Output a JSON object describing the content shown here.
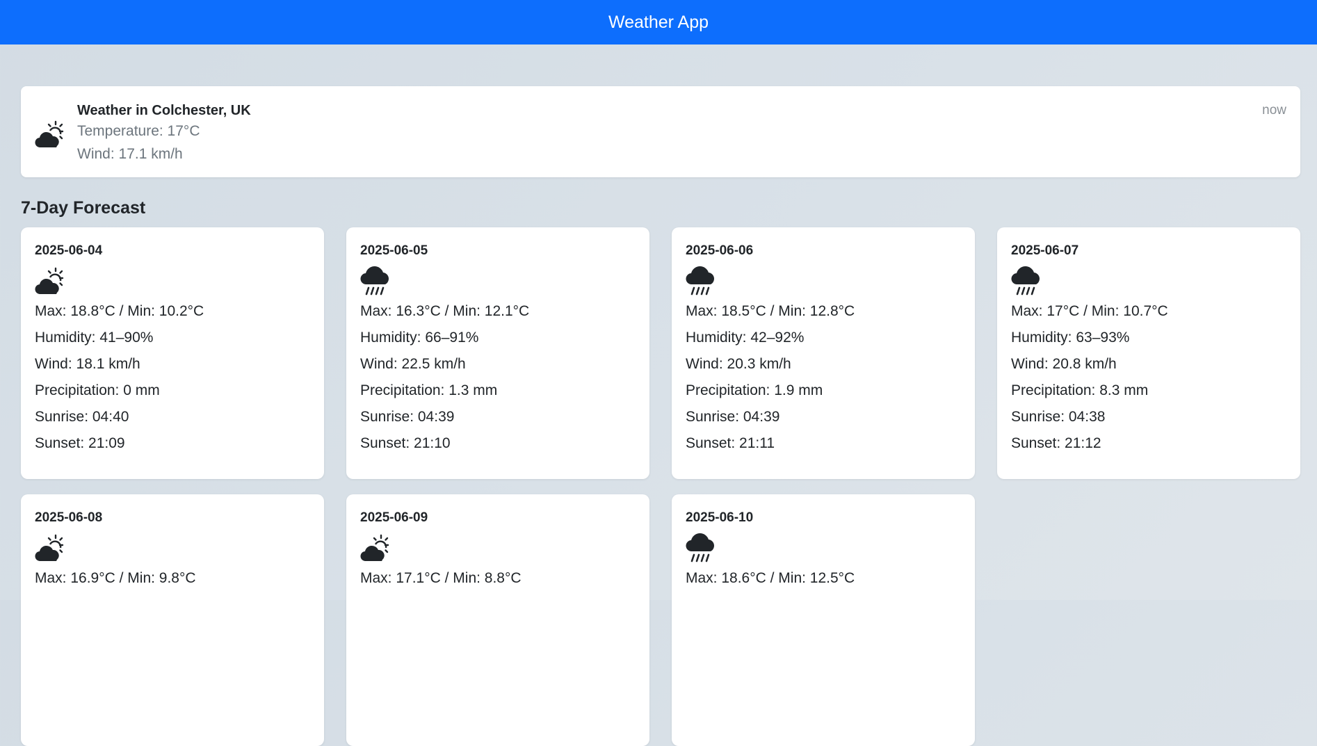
{
  "header": {
    "title": "Weather App"
  },
  "current": {
    "title": "Weather in Colchester, UK",
    "temperature": "Temperature: 17°C",
    "wind": "Wind: 17.1 km/h",
    "time": "now",
    "icon": "partly-cloudy-icon"
  },
  "forecast": {
    "title": "7-Day Forecast",
    "days": [
      {
        "date": "2025-06-04",
        "icon": "partly-cloudy-icon",
        "maxmin": "Max: 18.8°C / Min: 10.2°C",
        "humidity": "Humidity: 41–90%",
        "wind": "Wind: 18.1 km/h",
        "precipitation": "Precipitation: 0 mm",
        "sunrise": "Sunrise: 04:40",
        "sunset": "Sunset: 21:09"
      },
      {
        "date": "2025-06-05",
        "icon": "rain-cloud-icon",
        "maxmin": "Max: 16.3°C / Min: 12.1°C",
        "humidity": "Humidity: 66–91%",
        "wind": "Wind: 22.5 km/h",
        "precipitation": "Precipitation: 1.3 mm",
        "sunrise": "Sunrise: 04:39",
        "sunset": "Sunset: 21:10"
      },
      {
        "date": "2025-06-06",
        "icon": "rain-cloud-icon",
        "maxmin": "Max: 18.5°C / Min: 12.8°C",
        "humidity": "Humidity: 42–92%",
        "wind": "Wind: 20.3 km/h",
        "precipitation": "Precipitation: 1.9 mm",
        "sunrise": "Sunrise: 04:39",
        "sunset": "Sunset: 21:11"
      },
      {
        "date": "2025-06-07",
        "icon": "rain-cloud-icon",
        "maxmin": "Max: 17°C / Min: 10.7°C",
        "humidity": "Humidity: 63–93%",
        "wind": "Wind: 20.8 km/h",
        "precipitation": "Precipitation: 8.3 mm",
        "sunrise": "Sunrise: 04:38",
        "sunset": "Sunset: 21:12"
      },
      {
        "date": "2025-06-08",
        "icon": "partly-cloudy-icon",
        "maxmin": "Max: 16.9°C / Min: 9.8°C"
      },
      {
        "date": "2025-06-09",
        "icon": "partly-cloudy-icon",
        "maxmin": "Max: 17.1°C / Min: 8.8°C"
      },
      {
        "date": "2025-06-10",
        "icon": "rain-cloud-icon",
        "maxmin": "Max: 18.6°C / Min: 12.5°C"
      }
    ]
  }
}
